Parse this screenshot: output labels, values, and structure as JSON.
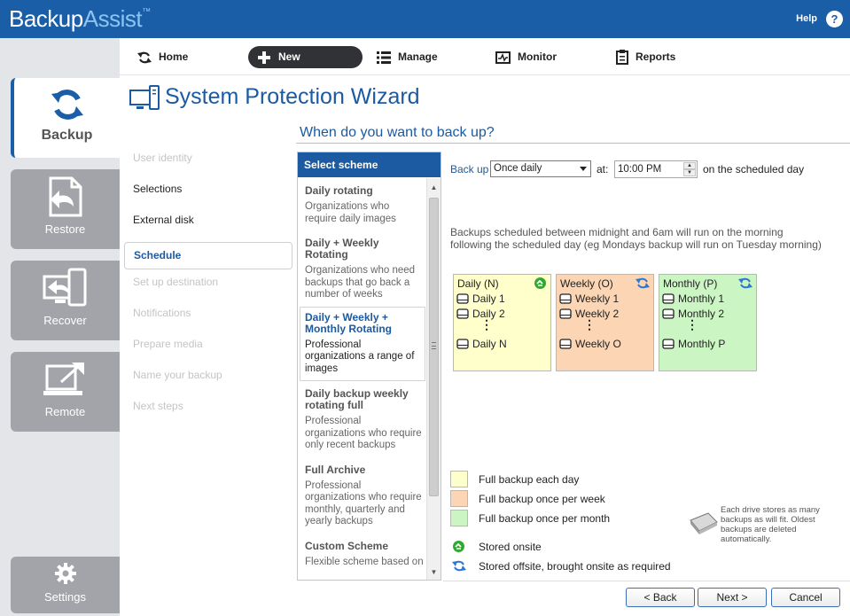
{
  "app": {
    "logo_backup": "Backup",
    "logo_assist": "Assist",
    "logo_tm": "™",
    "help_label": "Help",
    "help_icon_glyph": "?"
  },
  "left_nav": {
    "items": [
      {
        "label": "Backup",
        "icon": "backup-cycle-icon",
        "active": true
      },
      {
        "label": "Restore",
        "icon": "restore-file-icon",
        "active": false
      },
      {
        "label": "Recover",
        "icon": "recover-computer-icon",
        "active": false
      },
      {
        "label": "Remote",
        "icon": "remote-monitor-icon",
        "active": false
      },
      {
        "label": "Settings",
        "icon": "gear-icon",
        "active": false
      }
    ]
  },
  "top_menu": {
    "items": [
      {
        "label": "Home",
        "icon": "refresh-icon"
      },
      {
        "label": "New",
        "icon": "plus-icon"
      },
      {
        "label": "Manage",
        "icon": "list-icon"
      },
      {
        "label": "Monitor",
        "icon": "monitor-pulse-icon"
      },
      {
        "label": "Reports",
        "icon": "clipboard-icon"
      }
    ]
  },
  "wizard": {
    "title": "System Protection Wizard",
    "question": "When do you want to back up?",
    "steps": [
      {
        "label": "User identity",
        "state": "todo"
      },
      {
        "label": "Selections",
        "state": "done"
      },
      {
        "label": "External disk",
        "state": "done"
      },
      {
        "label": "Schedule",
        "state": "current"
      },
      {
        "label": "Set up destination",
        "state": "todo"
      },
      {
        "label": "Notifications",
        "state": "todo"
      },
      {
        "label": "Prepare media",
        "state": "todo"
      },
      {
        "label": "Name your backup",
        "state": "todo"
      },
      {
        "label": "Next steps",
        "state": "todo"
      }
    ]
  },
  "scheme_panel": {
    "header": "Select scheme",
    "schemes": [
      {
        "title": "Daily rotating",
        "desc": "Organizations who require daily images",
        "selected": false
      },
      {
        "title": "Daily + Weekly Rotating",
        "desc": "Organizations who need backups that go back a number of weeks",
        "selected": false
      },
      {
        "title": "Daily + Weekly + Monthly Rotating",
        "desc": "Professional organizations a range of images",
        "selected": true
      },
      {
        "title": "Daily backup weekly rotating full",
        "desc": "Professional organizations who require only recent backups",
        "selected": false
      },
      {
        "title": "Full Archive",
        "desc": "Professional organizations who require monthly, quarterly and yearly backups",
        "selected": false
      },
      {
        "title": "Custom Scheme",
        "desc": "Flexible scheme based on",
        "selected": false
      }
    ],
    "scroll_up_glyph": "▲",
    "scroll_down_glyph": "▼"
  },
  "schedule": {
    "backup_label": "Back up",
    "frequency_value": "Once daily",
    "at_label": "at:",
    "time_value": "10:00 PM",
    "spin_up": "▲",
    "spin_down": "▼",
    "scheduled_label": "on the scheduled day",
    "note": "Backups scheduled between midnight and 6am will run on the morning following the scheduled day (eg Mondays backup will run on Tuesday morning)"
  },
  "media": [
    {
      "title": "Daily (N)",
      "color": "#ffffcc",
      "icon": "onsite-icon",
      "rows": [
        "Daily 1",
        "Daily 2",
        "Daily N"
      ]
    },
    {
      "title": "Weekly (O)",
      "color": "#fcd5b4",
      "icon": "offsite-icon",
      "rows": [
        "Weekly 1",
        "Weekly 2",
        "Weekly O"
      ]
    },
    {
      "title": "Monthly (P)",
      "color": "#ccf5c4",
      "icon": "offsite-icon",
      "rows": [
        "Monthly 1",
        "Monthly 2",
        "Monthly P"
      ]
    }
  ],
  "dots_glyph": "⋮",
  "legend": {
    "swatches": [
      {
        "label": "Full backup each day",
        "color": "#ffffcc"
      },
      {
        "label": "Full backup once per week",
        "color": "#fcd5b4"
      },
      {
        "label": "Full backup once per month",
        "color": "#ccf5c4"
      }
    ],
    "icons": [
      {
        "label": "Stored onsite",
        "icon": "onsite-icon"
      },
      {
        "label": "Stored offsite, brought onsite as required",
        "icon": "offsite-icon"
      }
    ],
    "drive_note": "Each drive stores as many backups as will fit. Oldest backups are deleted automatically."
  },
  "buttons": {
    "back": "< Back",
    "next": "Next >",
    "cancel": "Cancel"
  },
  "colors": {
    "brand_blue": "#1a5ea8",
    "nav_tile": "#a2a4a9",
    "daily": "#ffffcc",
    "weekly": "#fcd5b4",
    "monthly": "#ccf5c4"
  }
}
